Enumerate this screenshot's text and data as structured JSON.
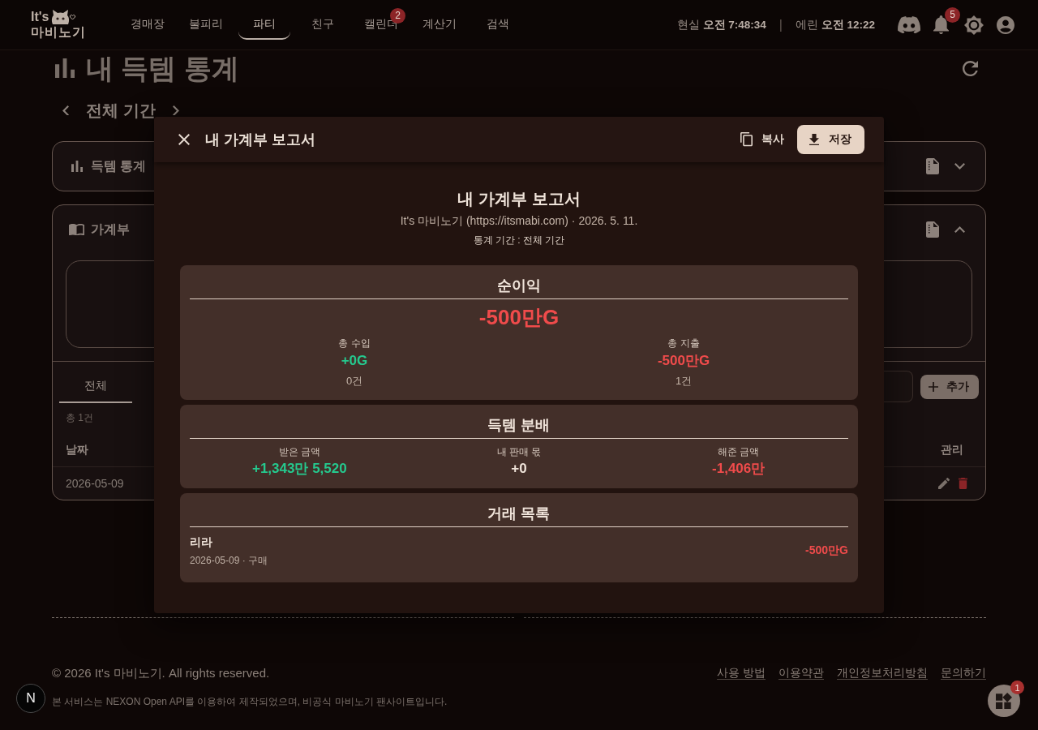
{
  "header": {
    "logo": {
      "line_1": "It's",
      "line_2": "마비노기"
    },
    "nav": [
      {
        "label": "경매장",
        "selected": false
      },
      {
        "label": "불피리",
        "selected": false
      },
      {
        "label": "파티",
        "selected": true
      },
      {
        "label": "친구",
        "selected": false
      },
      {
        "label": "캘린더",
        "selected": false,
        "badge": "2"
      },
      {
        "label": "계산기",
        "selected": false
      },
      {
        "label": "검색",
        "selected": false
      }
    ],
    "clocks": [
      "현실 **오전 7:48:34**",
      "에린 **오전 12:22**"
    ],
    "clock_separator": "|",
    "notification_badge": "5"
  },
  "page": {
    "title": "내 득템 통계",
    "period": "전체 기간",
    "stats_card": {
      "title": "득템 통계",
      "expanded": false
    },
    "ledger_card": {
      "title": "가계부",
      "expanded": true,
      "tabs": [
        {
          "label": "전체",
          "selected": true
        }
      ],
      "add_button": "추가",
      "total": "총 1건",
      "columns": [
        "날짜",
        "관리"
      ],
      "rows": [
        {
          "date": "2026-05-09"
        }
      ]
    }
  },
  "modal": {
    "title": "내 가계부 보고서",
    "copy_button": "복사",
    "save_button": "저장",
    "report": {
      "title": "내 가계부 보고서",
      "subtitle": "It's 마비노기 (https://itsmabi.com) · 2026. 5. 11.",
      "period": "통계 기간 : 전체 기간"
    },
    "sections": [
      {
        "kind": "summary",
        "title": "순이익",
        "total": {
          "value": "-500만G",
          "color": "#f04b4b"
        },
        "columns": [
          {
            "label": "총 수입",
            "value": "+0G",
            "color": "#25c98e",
            "count": "0건"
          },
          {
            "label": "총 지출",
            "value": "-500만G",
            "color": "#f04b4b",
            "count": "1건"
          }
        ]
      },
      {
        "kind": "split",
        "title": "득템 분배",
        "columns": [
          {
            "label": "받은 금액",
            "value": "+1,343만 5,520",
            "color": "#25c98e"
          },
          {
            "label": "내 판매 몫",
            "value": "+0",
            "color": "#efe3d9"
          },
          {
            "label": "해준 금액",
            "value": "-1,406만",
            "color": "#f04b4b"
          }
        ]
      },
      {
        "kind": "transactions",
        "title": "거래 목록",
        "items": [
          {
            "name": "리라",
            "meta": "2026-05-09 · 구매",
            "amount": "-500만G",
            "color": "#f04b4b"
          }
        ]
      }
    ]
  },
  "footer": {
    "copyright": "© 2026 It's 마비노기. All rights reserved.",
    "links": [
      "사용 방법",
      "이용약관",
      "개인정보처리방침",
      "문의하기"
    ],
    "disclaimer": "본 서비스는 NEXON Open API를 이용하여 제작되었으며, 비공식 마비노기 팬사이트입니다."
  },
  "dev_badge": "N",
  "widget_badge": "1"
}
